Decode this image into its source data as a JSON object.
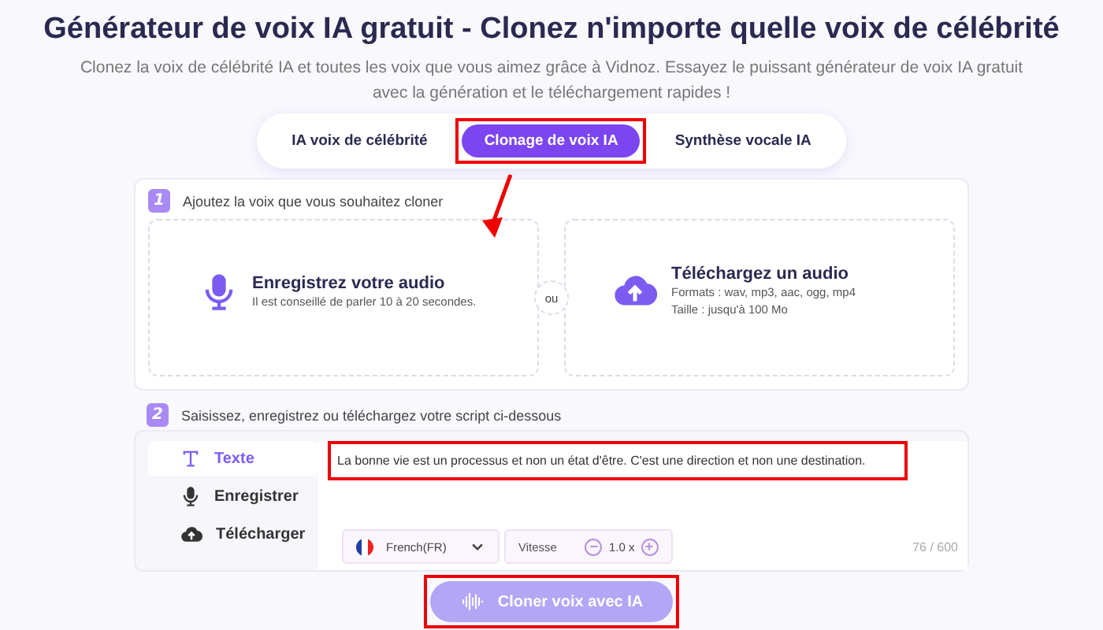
{
  "title": "Générateur de voix IA gratuit - Clonez n'importe quelle voix de célébrité",
  "subtitle": "Clonez la voix de célébrité IA et toutes les voix que vous aimez grâce à Vidnoz. Essayez le puissant générateur de voix IA gratuit avec la génération et le téléchargement rapides !",
  "tabs": [
    {
      "label": "IA voix de célébrité",
      "selected": false,
      "highlighted": false
    },
    {
      "label": "Clonage de voix IA",
      "selected": true,
      "highlighted": true
    },
    {
      "label": "Synthèse vocale IA",
      "selected": false,
      "highlighted": false
    }
  ],
  "step1": {
    "number": "1",
    "label": "Ajoutez la voix que vous souhaitez cloner",
    "arrow": true,
    "options": [
      {
        "kind": "record",
        "title": "Enregistrez votre audio",
        "lines": [
          "Il est conseillé de parler 10 à 20 secondes."
        ]
      },
      {
        "kind": "upload",
        "title": "Téléchargez un audio",
        "lines": [
          "Formats : wav, mp3, aac, ogg, mp4",
          "Taille : jusqu'à 100 Mo"
        ]
      }
    ],
    "separator": "ou"
  },
  "step2": {
    "number": "2",
    "label": "Saisissez, enregistrez ou téléchargez votre script ci-dessous",
    "modes": [
      {
        "kind": "text",
        "label": "Texte",
        "selected": true
      },
      {
        "kind": "record",
        "label": "Enregistrer",
        "selected": false
      },
      {
        "kind": "upload",
        "label": "Télécharger",
        "selected": false
      }
    ],
    "script": {
      "value": "La bonne vie est un processus et non un état d'être. C'est une direction et non une destination.",
      "highlighted": true
    },
    "language": "French(FR)",
    "speed_label": "Vitesse",
    "speed": "1.0 x",
    "counter": "76 / 600"
  },
  "clone_button": {
    "label": "Cloner voix avec IA",
    "disabled": true,
    "highlighted": true
  }
}
